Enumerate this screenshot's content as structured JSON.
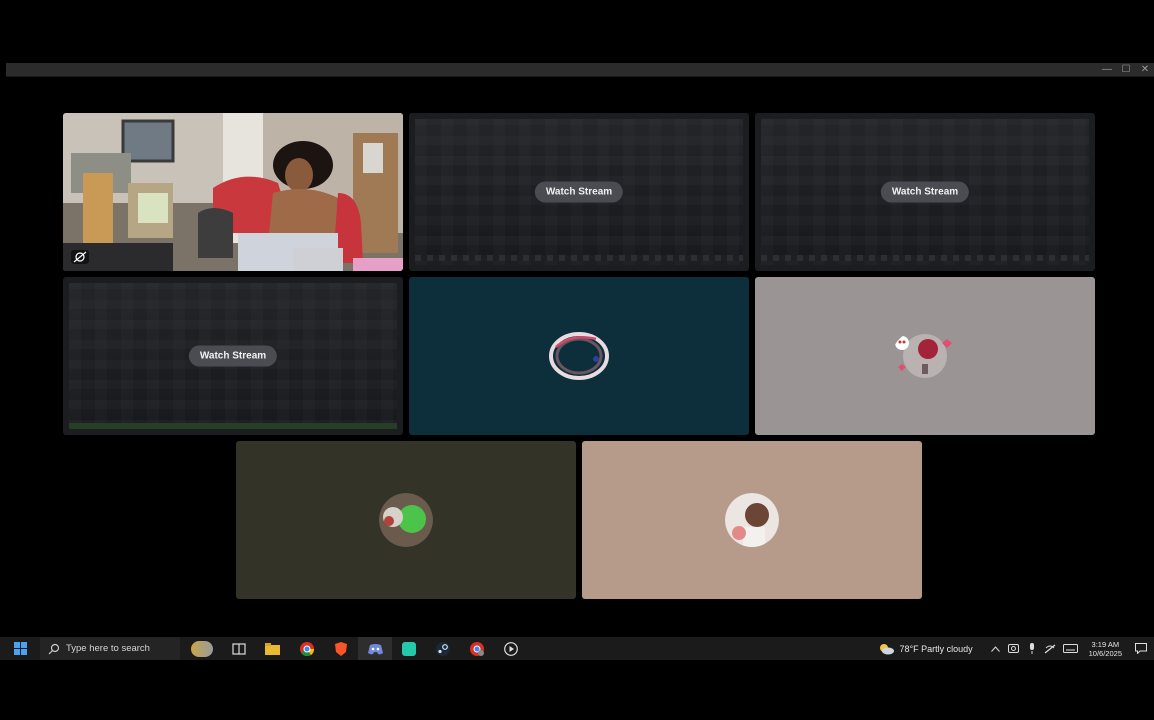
{
  "window": {
    "minimize_glyph": "—",
    "maximize_glyph": "☐",
    "close_glyph": "✕"
  },
  "tiles": {
    "watch_stream_label": "Watch Stream",
    "colors": {
      "stream_bg": "#1c1d20",
      "teal": "#0d2e3b",
      "gray": "#9a9594",
      "olive": "#333327",
      "tan": "#b69b8b"
    }
  },
  "taskbar": {
    "search_placeholder": "Type here to search",
    "weather": "78°F  Partly cloudy",
    "time": "3:19 AM",
    "date": "10/6/2025",
    "pinned_icons": [
      "start-icon",
      "search-icon",
      "profile-pic-icon",
      "task-view-icon",
      "file-explorer-icon",
      "chrome-icon",
      "brave-icon",
      "discord-icon",
      "app-icon",
      "steam-icon",
      "chrome-profile-icon",
      "media-player-icon"
    ]
  }
}
